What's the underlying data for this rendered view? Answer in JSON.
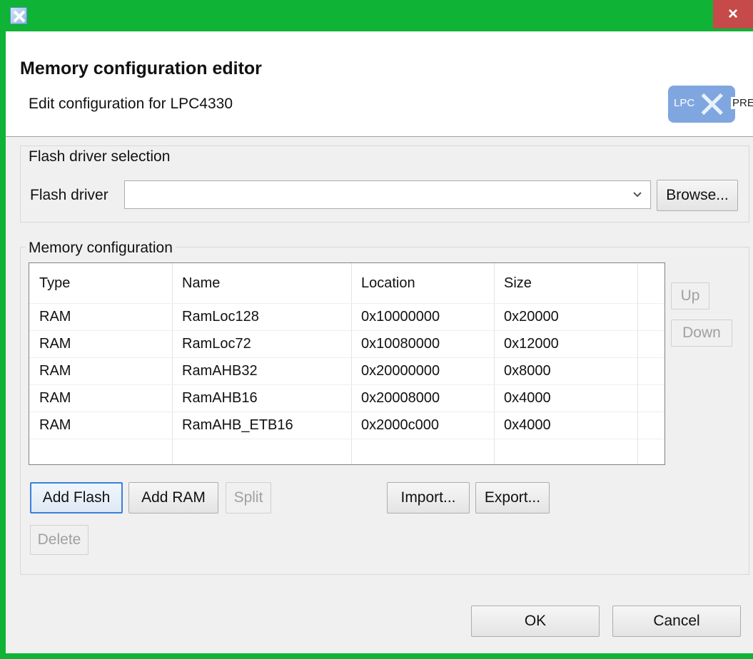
{
  "window": {
    "close_label": "×"
  },
  "header": {
    "title": "Memory configuration editor",
    "subtitle": "Edit configuration for LPC4330",
    "logo": {
      "left": "LPC",
      "right": "PRESSO"
    }
  },
  "flash_group": {
    "legend": "Flash driver selection",
    "label": "Flash driver",
    "value": "",
    "browse_label": "Browse..."
  },
  "memory_group": {
    "legend": "Memory configuration",
    "columns": [
      "Type",
      "Name",
      "Location",
      "Size"
    ],
    "rows": [
      {
        "type": "RAM",
        "name": "RamLoc128",
        "location": "0x10000000",
        "size": "0x20000"
      },
      {
        "type": "RAM",
        "name": "RamLoc72",
        "location": "0x10080000",
        "size": "0x12000"
      },
      {
        "type": "RAM",
        "name": "RamAHB32",
        "location": "0x20000000",
        "size": "0x8000"
      },
      {
        "type": "RAM",
        "name": "RamAHB16",
        "location": "0x20008000",
        "size": "0x4000"
      },
      {
        "type": "RAM",
        "name": "RamAHB_ETB16",
        "location": "0x2000c000",
        "size": "0x4000"
      }
    ],
    "up_label": "Up",
    "down_label": "Down",
    "add_flash_label": "Add Flash",
    "add_ram_label": "Add RAM",
    "split_label": "Split",
    "import_label": "Import...",
    "export_label": "Export...",
    "delete_label": "Delete"
  },
  "footer": {
    "ok_label": "OK",
    "cancel_label": "Cancel"
  },
  "colors": {
    "title_bar": "#0fb336",
    "close_button": "#c74a4a",
    "dialog_bg": "#f0f0f0",
    "default_button_border": "#3c7fd8"
  }
}
